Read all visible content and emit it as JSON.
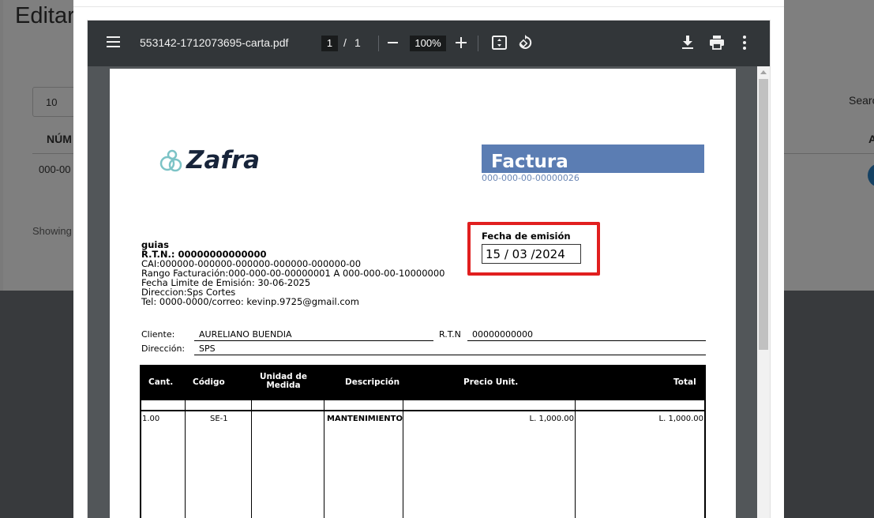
{
  "background_page": {
    "title": "Editar",
    "entries_select": "10",
    "search_label": "Search",
    "column_num": "NÚM",
    "column_a": "A",
    "row_num": "000-00",
    "showing_text": "Showing"
  },
  "pdf_viewer": {
    "file_name": "553142-1712073695-carta.pdf",
    "page_current": "1",
    "page_separator": "/",
    "page_total": "1",
    "zoom": "100%"
  },
  "invoice": {
    "logo_text": "Zafra",
    "title": "Factura",
    "number": "000-000-00-00000026",
    "fecha_label": "Fecha de emisión",
    "fecha_value": "15 / 03 /2024",
    "company": {
      "name": "guias",
      "rtn": "R.T.N.: 00000000000000",
      "cai": "CAI:000000-000000-000000-000000-000000-00",
      "rango": "Rango Facturación:000-000-00-00000001 A 000-000-00-10000000",
      "fecha_limite": "Fecha Limite de Emisión: 30-06-2025",
      "direccion": "Direccion:Sps Cortes",
      "contacto": "Tel: 0000-0000/correo: kevinp.9725@gmail.com"
    },
    "client": {
      "cliente_label": "Cliente:",
      "cliente_value": "AURELIANO BUENDIA",
      "rtn_label": "R.T.N",
      "rtn_value": "00000000000",
      "direccion_label": "Dirección:",
      "direccion_value": "SPS"
    },
    "table": {
      "headers": {
        "cant": "Cant.",
        "codigo": "Código",
        "unidad": "Unidad de Medida",
        "descripcion": "Descripción",
        "precio": "Precio Unit.",
        "total": "Total"
      },
      "rows": [
        {
          "cant": "1.00",
          "codigo": "SE-1",
          "unidad": "",
          "descripcion": "MANTENIMIENTO",
          "precio": "L. 1,000.00",
          "total": "L. 1,000.00"
        }
      ]
    }
  }
}
